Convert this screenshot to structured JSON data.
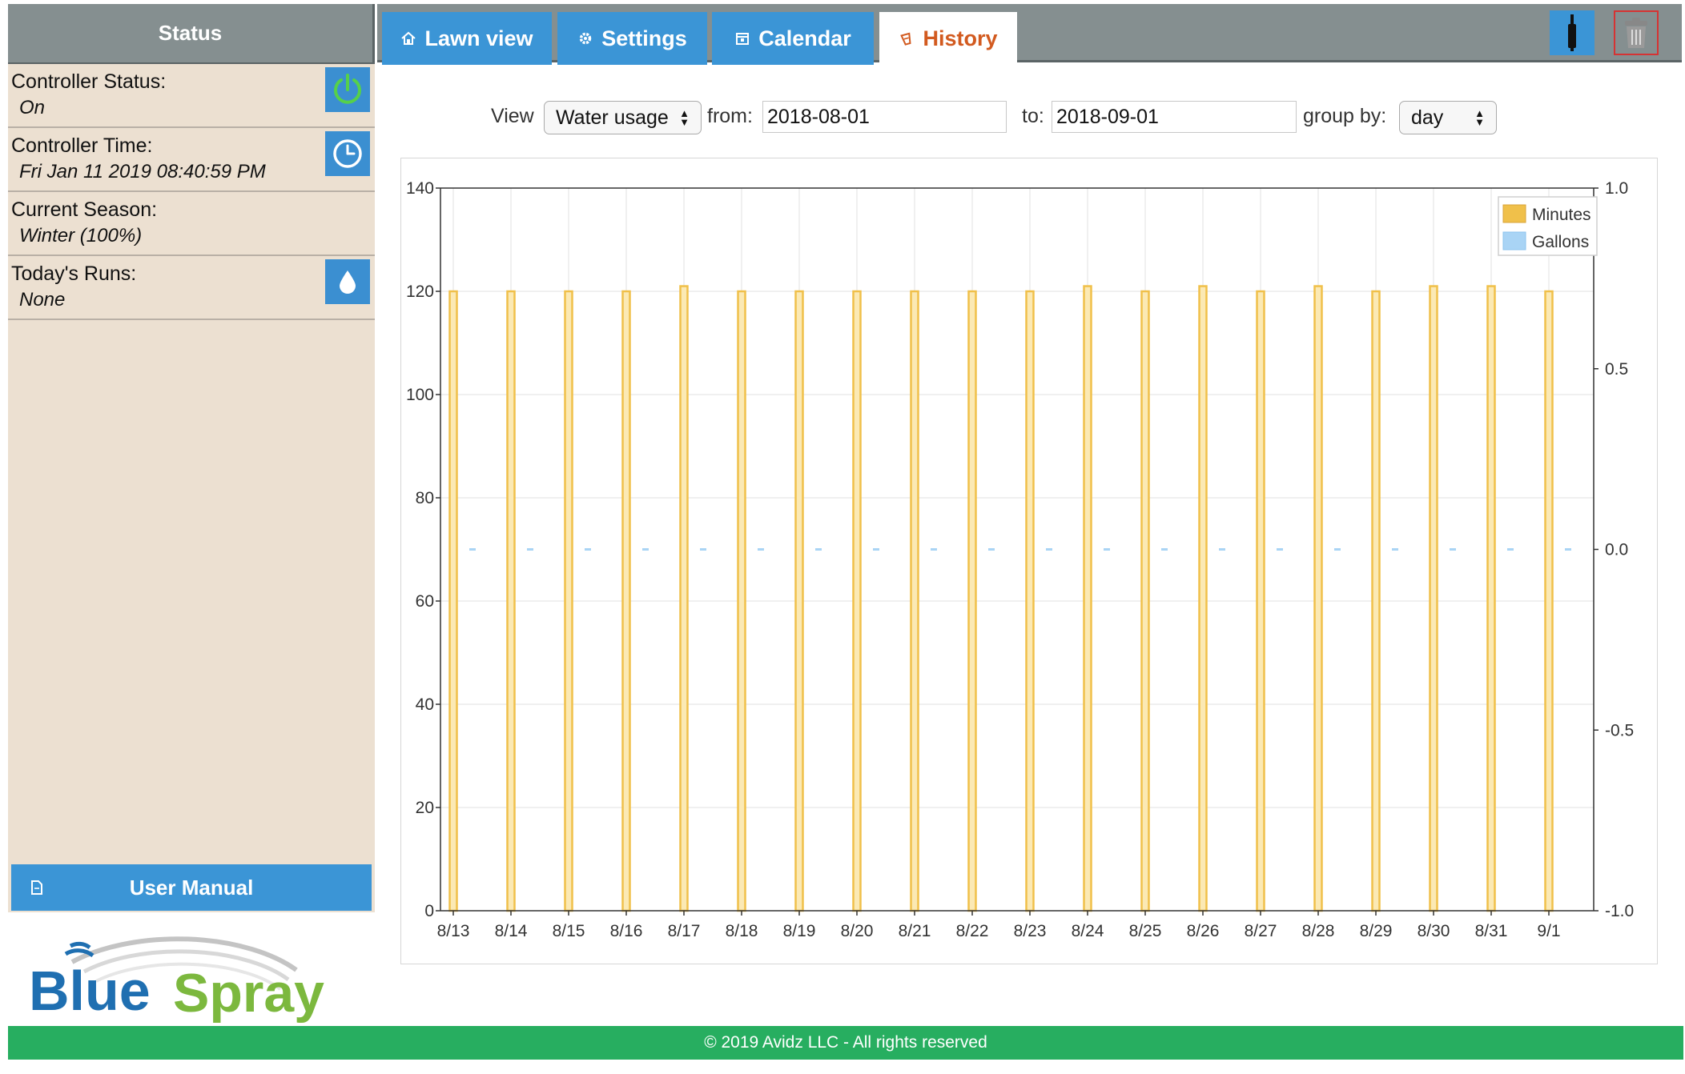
{
  "sidebar": {
    "title": "Status",
    "controller_status": {
      "label": "Controller Status:",
      "value": "On",
      "icon": "power-icon"
    },
    "controller_time": {
      "label": "Controller Time:",
      "value": "Fri Jan 11 2019 08:40:59 PM",
      "icon": "clock-icon"
    },
    "current_season": {
      "label": "Current Season:",
      "value": "Winter (100%)"
    },
    "todays_runs": {
      "label": "Today's Runs:",
      "value": "None",
      "icon": "water-drop-icon"
    },
    "user_manual": "User Manual"
  },
  "logo": {
    "text_blue": "Blue",
    "text_green": "Spray"
  },
  "tabs": [
    {
      "label": "Lawn view",
      "icon": "home-icon"
    },
    {
      "label": "Settings",
      "icon": "gear-icon"
    },
    {
      "label": "Calendar",
      "icon": "calendar-icon"
    },
    {
      "label": "History",
      "icon": "history-icon",
      "active": true
    }
  ],
  "toolbar": {
    "remote_icon": "remote-icon",
    "trash_icon": "trash-icon"
  },
  "filters": {
    "view_label": "View",
    "view_value": "Water usage",
    "from_label": "from:",
    "from_value": "2018-08-01",
    "to_label": "to:",
    "to_value": "2018-09-01",
    "group_label": "group by:",
    "group_value": "day"
  },
  "chart_data": {
    "type": "bar",
    "categories": [
      "8/13",
      "8/14",
      "8/15",
      "8/16",
      "8/17",
      "8/18",
      "8/19",
      "8/20",
      "8/21",
      "8/22",
      "8/23",
      "8/24",
      "8/25",
      "8/26",
      "8/27",
      "8/28",
      "8/29",
      "8/30",
      "8/31",
      "9/1"
    ],
    "series": [
      {
        "name": "Minutes",
        "axis": "left",
        "color": "#f0c04a",
        "values": [
          120,
          120,
          120,
          120,
          121,
          120,
          120,
          120,
          120,
          120,
          120,
          121,
          120,
          121,
          120,
          121,
          120,
          121,
          121,
          120
        ]
      },
      {
        "name": "Gallons",
        "axis": "right",
        "color": "#a9d4f5",
        "values": [
          0,
          0,
          0,
          0,
          0,
          0,
          0,
          0,
          0,
          0,
          0,
          0,
          0,
          0,
          0,
          0,
          0,
          0,
          0,
          0
        ]
      }
    ],
    "ylim_left": [
      0,
      140
    ],
    "yticks_left": [
      0,
      20,
      40,
      60,
      80,
      100,
      120,
      140
    ],
    "ylim_right": [
      -1.0,
      1.0
    ],
    "yticks_right": [
      "1.0",
      "0.5",
      "0.0",
      "-0.5",
      "-1.0"
    ],
    "legend": "top-right",
    "grid": true
  },
  "footer": "© 2019 Avidz LLC - All rights reserved"
}
